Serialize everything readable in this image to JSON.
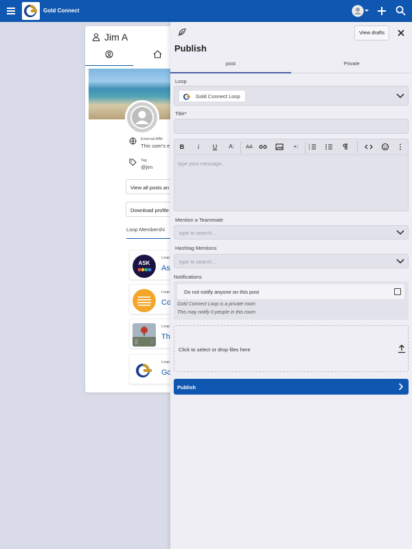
{
  "app": {
    "brand": "Gold Connect",
    "accent": "#0f57b0"
  },
  "topbar": {
    "icons": [
      "menu-icon",
      "brand-logo",
      "avatar-icon",
      "chevron-down-icon",
      "plus-icon",
      "search-icon"
    ]
  },
  "profile": {
    "name": "Jim A",
    "affiliation_label": "External Affili",
    "affiliation_value": "This user's e",
    "tag_label": "Tag",
    "tag_value": "@jim",
    "view_posts_label": "View all posts an",
    "download_label": "Download profile",
    "loops_tab_label": "Loop Membershi",
    "loops": [
      {
        "prefix": "Loop",
        "name": "Ask"
      },
      {
        "prefix": "Loop",
        "name": "Co"
      },
      {
        "prefix": "Loop",
        "name": "The"
      },
      {
        "prefix": "Loop",
        "name": "Gol"
      }
    ]
  },
  "publish": {
    "title": "Publish",
    "view_drafts_label": "View drafts",
    "tabs": [
      {
        "label": "post",
        "active": true
      },
      {
        "label": "Private",
        "active": false
      }
    ],
    "loop_label": "Loop",
    "loop_selected": "Gold Connect Loop",
    "title_label": "Title*",
    "editor_placeholder": "type your message...",
    "toolbar": {
      "bold": "B",
      "italic": "i",
      "underline": "U",
      "text_size": "A:",
      "font_case": "AA",
      "insert": "+:"
    },
    "mention_label": "Mention a Teammate",
    "mention_placeholder": "type to search...",
    "hashtag_label": "Hashtag Mentions",
    "hashtag_placeholder": "type to search...",
    "notifications_label": "Notifications",
    "notify_option": "Do not notify anyone on this post",
    "notify_checked": false,
    "private_note": "Gold Connect Loop is a private room",
    "notify_count_note": "This may notify 0 people in this room",
    "dropzone_label": "Click to select or drop files here",
    "publish_button": "Publish"
  }
}
